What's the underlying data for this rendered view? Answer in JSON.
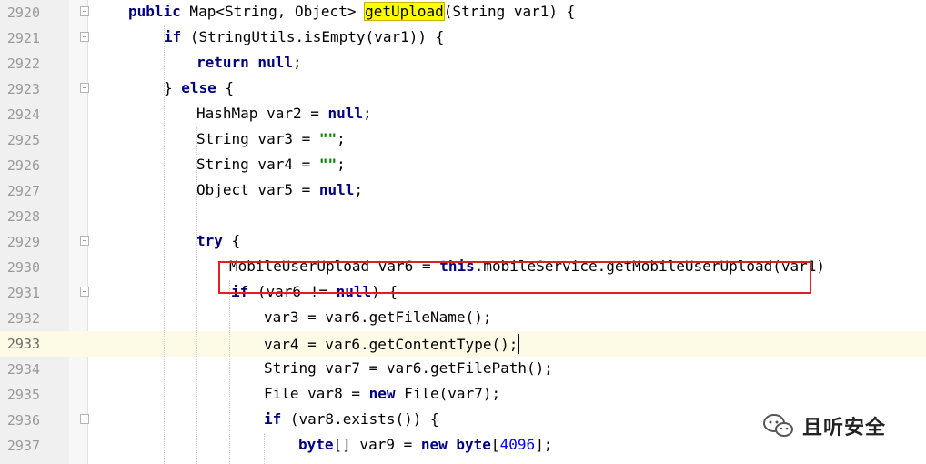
{
  "editor": {
    "current_line": "2933",
    "lines": [
      {
        "num": "2920",
        "tokens": [
          [
            "kw",
            "public"
          ],
          [
            "t",
            " Map<String, Object> "
          ],
          [
            "hl",
            "getUpload"
          ],
          [
            "t",
            "(String var1) {"
          ]
        ]
      },
      {
        "num": "2921",
        "tokens": [
          [
            "kw",
            "if"
          ],
          [
            "t",
            " (StringUtils.isEmpty(var1)) {"
          ]
        ]
      },
      {
        "num": "2922",
        "tokens": [
          [
            "kw",
            "return null"
          ],
          [
            "t",
            ";"
          ]
        ]
      },
      {
        "num": "2923",
        "tokens": [
          [
            "t",
            "} "
          ],
          [
            "kw",
            "else"
          ],
          [
            "t",
            " {"
          ]
        ]
      },
      {
        "num": "2924",
        "tokens": [
          [
            "t",
            "HashMap var2 = "
          ],
          [
            "kw",
            "null"
          ],
          [
            "t",
            ";"
          ]
        ]
      },
      {
        "num": "2925",
        "tokens": [
          [
            "t",
            "String var3 = "
          ],
          [
            "str",
            "\"\""
          ],
          [
            "t",
            ";"
          ]
        ]
      },
      {
        "num": "2926",
        "tokens": [
          [
            "t",
            "String var4 = "
          ],
          [
            "str",
            "\"\""
          ],
          [
            "t",
            ";"
          ]
        ]
      },
      {
        "num": "2927",
        "tokens": [
          [
            "t",
            "Object var5 = "
          ],
          [
            "kw",
            "null"
          ],
          [
            "t",
            ";"
          ]
        ]
      },
      {
        "num": "2928",
        "tokens": []
      },
      {
        "num": "2929",
        "tokens": [
          [
            "kw",
            "try"
          ],
          [
            "t",
            " {"
          ]
        ]
      },
      {
        "num": "2930",
        "tokens": [
          [
            "t",
            "MobileUserUpload var6 = "
          ],
          [
            "kw",
            "this"
          ],
          [
            "t",
            ".mobileService.getMobileUserUpload(var1)"
          ]
        ]
      },
      {
        "num": "2931",
        "tokens": [
          [
            "kw",
            "if"
          ],
          [
            "t",
            " (var6 != "
          ],
          [
            "kw",
            "null"
          ],
          [
            "t",
            ") {"
          ]
        ]
      },
      {
        "num": "2932",
        "tokens": [
          [
            "t",
            "var3 = var6.getFileName();"
          ]
        ]
      },
      {
        "num": "2933",
        "tokens": [
          [
            "t",
            "var4 = var6.getContentType();"
          ]
        ]
      },
      {
        "num": "2934",
        "tokens": [
          [
            "t",
            "String var7 = var6.getFilePath();"
          ]
        ]
      },
      {
        "num": "2935",
        "tokens": [
          [
            "t",
            "File var8 = "
          ],
          [
            "kw",
            "new"
          ],
          [
            "t",
            " File(var7);"
          ]
        ]
      },
      {
        "num": "2936",
        "tokens": [
          [
            "kw",
            "if"
          ],
          [
            "t",
            " (var8.exists()) {"
          ]
        ]
      },
      {
        "num": "2937",
        "tokens": [
          [
            "kw",
            "byte"
          ],
          [
            "t",
            "[] var9 = "
          ],
          [
            "kw",
            "new byte"
          ],
          [
            "t",
            "["
          ],
          [
            "num",
            "4096"
          ],
          [
            "t",
            "];"
          ]
        ]
      }
    ]
  },
  "watermark": {
    "text": "且听安全",
    "icon": "wechat-icon"
  },
  "colors": {
    "keyword": "#000080",
    "string": "#008000",
    "number": "#0000ff",
    "highlight": "#ffff00",
    "redbox": "#e02020"
  }
}
